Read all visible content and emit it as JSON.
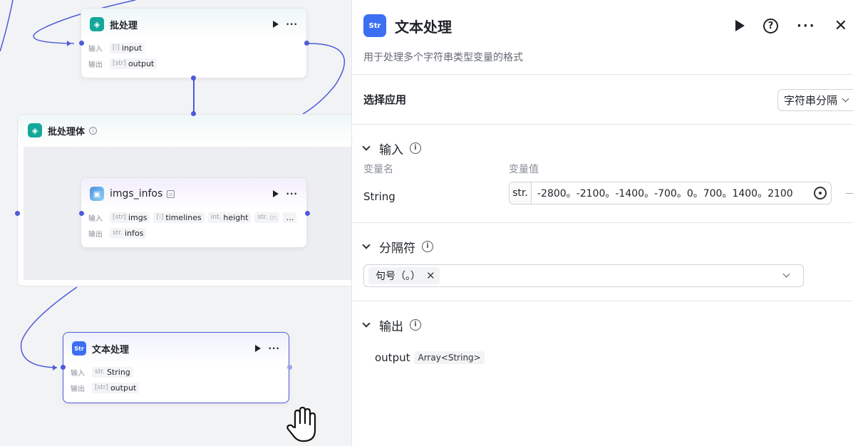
{
  "canvas": {
    "batch_node": {
      "title": "批处理",
      "input_label": "输入",
      "input_tag_type": "[⁝]",
      "input_tag": "input",
      "output_label": "输出",
      "output_tag_type": "[str]",
      "output_tag": "output"
    },
    "batch_body": {
      "title": "批处理体"
    },
    "imgs_node": {
      "title": "imgs_infos",
      "input_label": "输入",
      "output_label": "输出",
      "inputs": [
        {
          "type": "[str]",
          "name": "imgs"
        },
        {
          "type": "[⁝]",
          "name": "timelines"
        },
        {
          "type": "int.",
          "name": "height"
        },
        {
          "type": "str.",
          "name": "in"
        }
      ],
      "more": "…",
      "output_tag_type": "str.",
      "output_tag": "infos"
    },
    "text_node": {
      "title": "文本处理",
      "input_label": "输入",
      "input_tag_type": "str.",
      "input_tag": "String",
      "output_label": "输出",
      "output_tag_type": "[str]",
      "output_tag": "output"
    }
  },
  "panel": {
    "icon_text": "Str",
    "title": "文本处理",
    "description": "用于处理多个字符串类型变量的格式",
    "app_section": {
      "label": "选择应用",
      "selected": "字符串分隔"
    },
    "input_section": {
      "title": "输入",
      "col_name": "变量名",
      "col_value": "变量值",
      "var_name": "String",
      "var_type": "str.",
      "var_value": "-2800。-2100。-1400。-700。0。700。1400。2100"
    },
    "separator_section": {
      "title": "分隔符",
      "chip": "句号（。）"
    },
    "output_section": {
      "title": "输出",
      "name": "output",
      "type": "Array<String>"
    }
  }
}
